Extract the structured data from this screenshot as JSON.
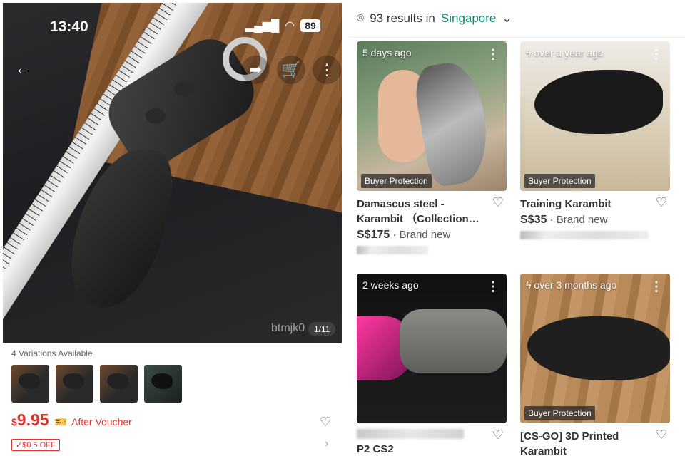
{
  "status": {
    "time": "13:40",
    "battery": "89"
  },
  "product": {
    "image_counter": "1/11",
    "watermark": "btmjk0",
    "variations_label": "4 Variations Available",
    "currency_symbol": "$",
    "price": "9.95",
    "after_voucher": "After Voucher",
    "off_badge": "✓$0.5 OFF"
  },
  "search": {
    "results_prefix": "93 results in",
    "location": "Singapore"
  },
  "listings": [
    {
      "time": "5 days ago",
      "badge": "Buyer Protection",
      "title": "Damascus steel - Karambit （Collection…",
      "price": "S$175",
      "condition": "· Brand new"
    },
    {
      "time": "over a year ago",
      "badge": "Buyer Protection",
      "title": "Training Karambit",
      "price": "S$35",
      "condition": "· Brand new"
    },
    {
      "time": "2 weeks ago",
      "badge": "",
      "title": "P2 CS2",
      "price": "",
      "condition": ""
    },
    {
      "time": "over 3 months ago",
      "badge": "Buyer Protection",
      "title": "[CS-GO] 3D Printed Karambit",
      "price": "",
      "condition": ""
    }
  ],
  "icons": {
    "back": "back-arrow-icon",
    "share": "share-icon",
    "cart": "cart-icon",
    "heart": "heart-icon",
    "location": "location-pin-icon",
    "more": "more-vertical-icon",
    "bolt": "bolt-icon"
  },
  "colors": {
    "price_red": "#e5312c",
    "location_green": "#158a6e"
  }
}
